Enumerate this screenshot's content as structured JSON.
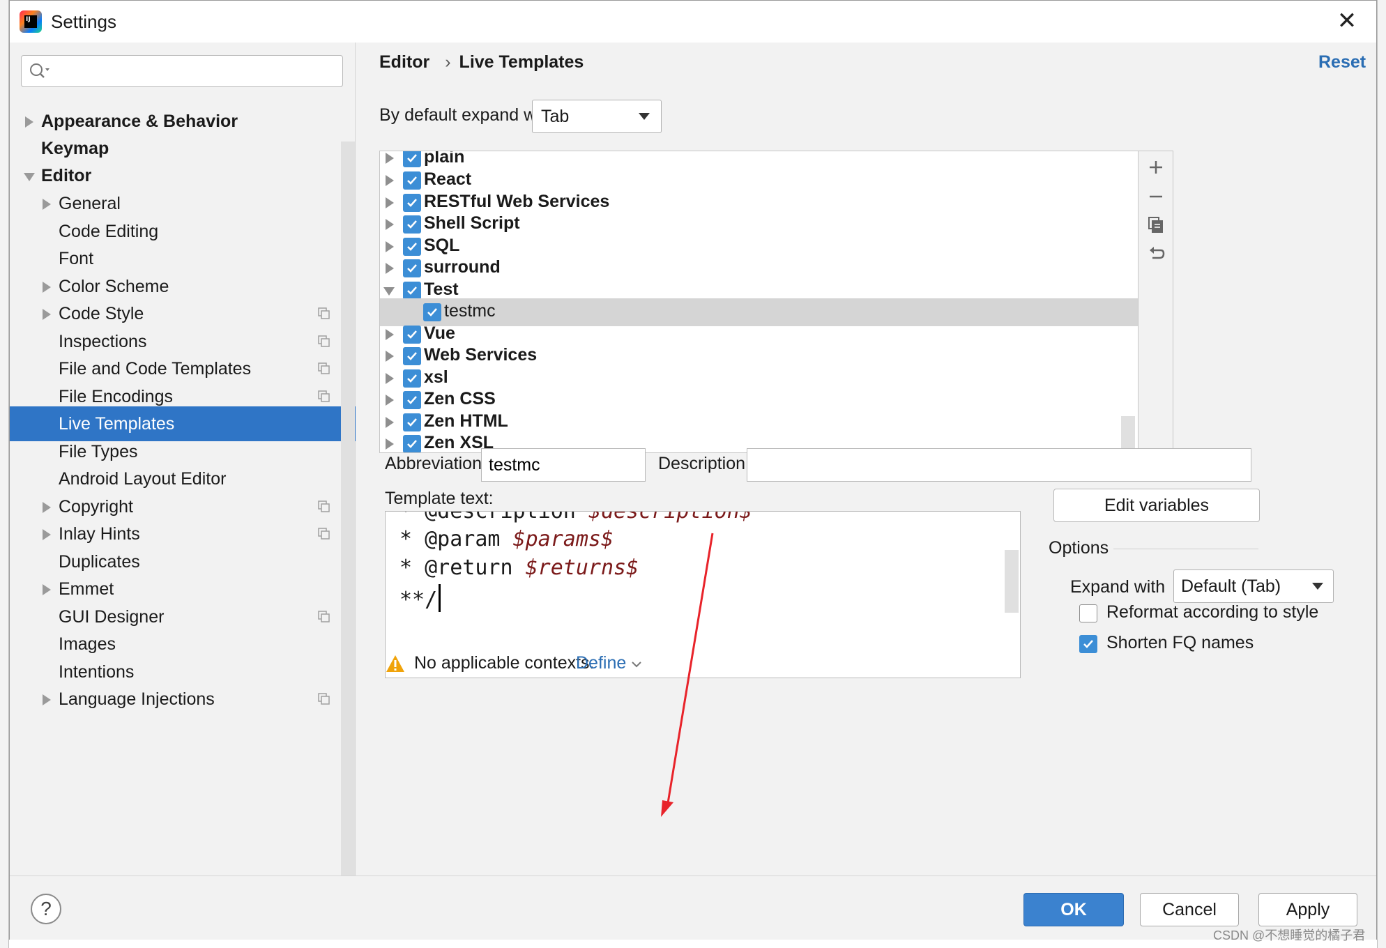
{
  "window": {
    "title": "Settings",
    "close_glyph": "✕"
  },
  "search": {
    "placeholder": ""
  },
  "sidebar": {
    "items": [
      {
        "label": "Appearance & Behavior",
        "bold": true
      },
      {
        "label": "Keymap",
        "bold": true
      },
      {
        "label": "Editor",
        "bold": true
      },
      {
        "label": "General"
      },
      {
        "label": "Code Editing"
      },
      {
        "label": "Font"
      },
      {
        "label": "Color Scheme"
      },
      {
        "label": "Code Style"
      },
      {
        "label": "Inspections"
      },
      {
        "label": "File and Code Templates"
      },
      {
        "label": "File Encodings"
      },
      {
        "label": "Live Templates",
        "selected": true
      },
      {
        "label": "File Types"
      },
      {
        "label": "Android Layout Editor"
      },
      {
        "label": "Copyright"
      },
      {
        "label": "Inlay Hints"
      },
      {
        "label": "Duplicates"
      },
      {
        "label": "Emmet"
      },
      {
        "label": "GUI Designer"
      },
      {
        "label": "Images"
      },
      {
        "label": "Intentions"
      },
      {
        "label": "Language Injections"
      }
    ]
  },
  "breadcrumb": {
    "parent": "Editor",
    "separator": "›",
    "current": "Live Templates"
  },
  "reset_label": "Reset",
  "expand_default": {
    "label": "By default expand with",
    "value": "Tab"
  },
  "template_list": {
    "rows": [
      {
        "label": "plain",
        "checked": true
      },
      {
        "label": "React",
        "checked": true
      },
      {
        "label": "RESTful Web Services",
        "checked": true
      },
      {
        "label": "Shell Script",
        "checked": true
      },
      {
        "label": "SQL",
        "checked": true
      },
      {
        "label": "surround",
        "checked": true
      },
      {
        "label": "Test",
        "checked": true,
        "expanded": true
      },
      {
        "label": "testmc",
        "checked": true,
        "child": true,
        "selected": true
      },
      {
        "label": "Vue",
        "checked": true
      },
      {
        "label": "Web Services",
        "checked": true
      },
      {
        "label": "xsl",
        "checked": true
      },
      {
        "label": "Zen CSS",
        "checked": true
      },
      {
        "label": "Zen HTML",
        "checked": true
      },
      {
        "label": "Zen XSL",
        "checked": true
      }
    ],
    "tools": [
      "add-icon",
      "remove-icon",
      "copy-icon",
      "restore-icon"
    ]
  },
  "abbreviation": {
    "label": "Abbreviation:",
    "value": "testmc"
  },
  "description": {
    "label": "Description:",
    "value": ""
  },
  "template_text": {
    "label": "Template text:",
    "lines": [
      {
        "prefix": "* @description ",
        "var": "$description$"
      },
      {
        "prefix": "* @param ",
        "var": "$params$"
      },
      {
        "prefix": "* @return ",
        "var": "$returns$"
      },
      {
        "prefix": "**/",
        "var": ""
      }
    ]
  },
  "context": {
    "warning": "No applicable contexts.",
    "define_label": "Define"
  },
  "edit_variables_label": "Edit variables",
  "options": {
    "title": "Options",
    "expand_with_label": "Expand with",
    "expand_with_value": "Default (Tab)",
    "reformat_label": "Reformat according to style",
    "reformat_checked": false,
    "shorten_label": "Shorten FQ names",
    "shorten_checked": true
  },
  "footer": {
    "help": "?",
    "ok": "OK",
    "cancel": "Cancel",
    "apply": "Apply"
  },
  "watermark": "CSDN @不想睡觉的橘子君",
  "colors": {
    "accent": "#2f75c6",
    "checkbox": "#3c8ed6",
    "link": "#2a6db3",
    "template_var": "#7b1a1a",
    "annotation": "#e8232a"
  }
}
